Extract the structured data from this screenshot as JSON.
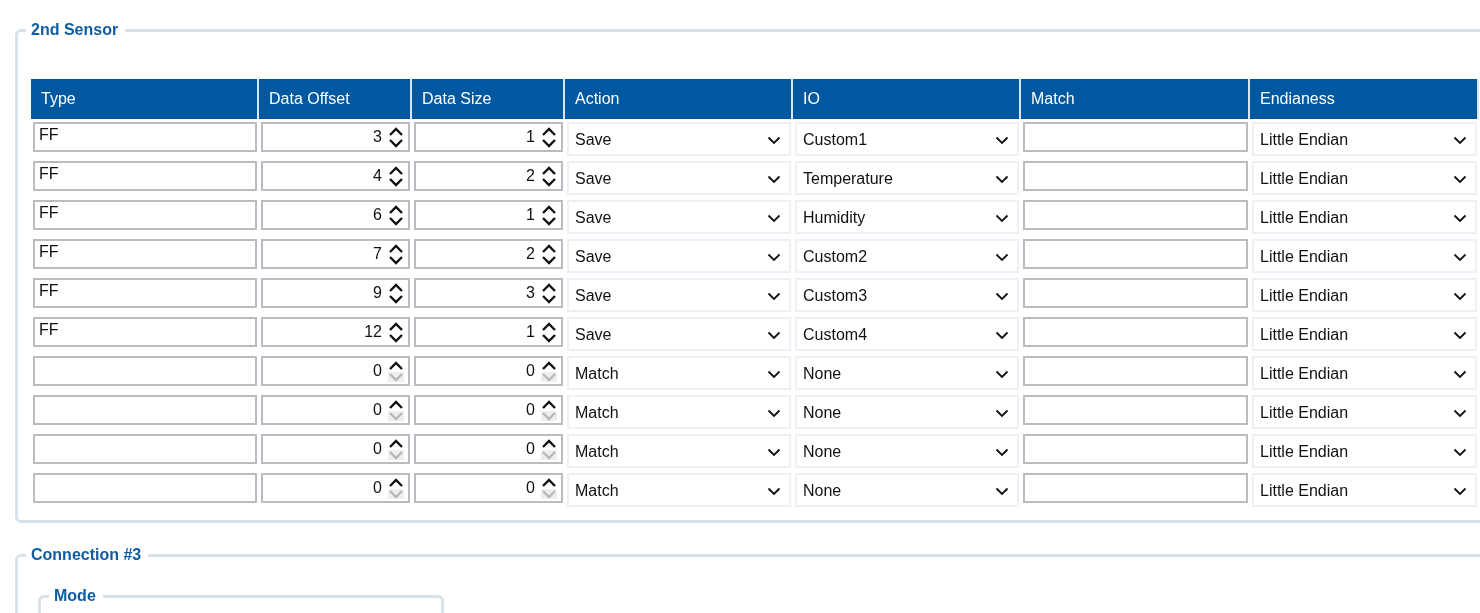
{
  "sections": [
    {
      "title": "2nd Sensor",
      "table": {
        "columns": [
          "Type",
          "Data Offset",
          "Data Size",
          "Action",
          "IO",
          "Match",
          "Endianess"
        ],
        "rows": [
          {
            "type": "FF",
            "data_offset": {
              "value": "3",
              "down_disabled": false
            },
            "data_size": {
              "value": "1",
              "down_disabled": false
            },
            "action": "Save",
            "io": "Custom1",
            "match": "",
            "endianess": "Little Endian"
          },
          {
            "type": "FF",
            "data_offset": {
              "value": "4",
              "down_disabled": false
            },
            "data_size": {
              "value": "2",
              "down_disabled": false
            },
            "action": "Save",
            "io": "Temperature",
            "match": "",
            "endianess": "Little Endian"
          },
          {
            "type": "FF",
            "data_offset": {
              "value": "6",
              "down_disabled": false
            },
            "data_size": {
              "value": "1",
              "down_disabled": false
            },
            "action": "Save",
            "io": "Humidity",
            "match": "",
            "endianess": "Little Endian"
          },
          {
            "type": "FF",
            "data_offset": {
              "value": "7",
              "down_disabled": false
            },
            "data_size": {
              "value": "2",
              "down_disabled": false
            },
            "action": "Save",
            "io": "Custom2",
            "match": "",
            "endianess": "Little Endian"
          },
          {
            "type": "FF",
            "data_offset": {
              "value": "9",
              "down_disabled": false
            },
            "data_size": {
              "value": "3",
              "down_disabled": false
            },
            "action": "Save",
            "io": "Custom3",
            "match": "",
            "endianess": "Little Endian"
          },
          {
            "type": "FF",
            "data_offset": {
              "value": "12",
              "down_disabled": false
            },
            "data_size": {
              "value": "1",
              "down_disabled": false
            },
            "action": "Save",
            "io": "Custom4",
            "match": "",
            "endianess": "Little Endian"
          },
          {
            "type": "",
            "data_offset": {
              "value": "0",
              "down_disabled": true
            },
            "data_size": {
              "value": "0",
              "down_disabled": true
            },
            "action": "Match",
            "io": "None",
            "match": "",
            "endianess": "Little Endian"
          },
          {
            "type": "",
            "data_offset": {
              "value": "0",
              "down_disabled": true
            },
            "data_size": {
              "value": "0",
              "down_disabled": true
            },
            "action": "Match",
            "io": "None",
            "match": "",
            "endianess": "Little Endian"
          },
          {
            "type": "",
            "data_offset": {
              "value": "0",
              "down_disabled": true
            },
            "data_size": {
              "value": "0",
              "down_disabled": true
            },
            "action": "Match",
            "io": "None",
            "match": "",
            "endianess": "Little Endian"
          },
          {
            "type": "",
            "data_offset": {
              "value": "0",
              "down_disabled": true
            },
            "data_size": {
              "value": "0",
              "down_disabled": true
            },
            "action": "Match",
            "io": "None",
            "match": "",
            "endianess": "Little Endian"
          }
        ]
      }
    },
    {
      "title": "Connection #3",
      "subsection": {
        "title": "Mode"
      }
    }
  ]
}
